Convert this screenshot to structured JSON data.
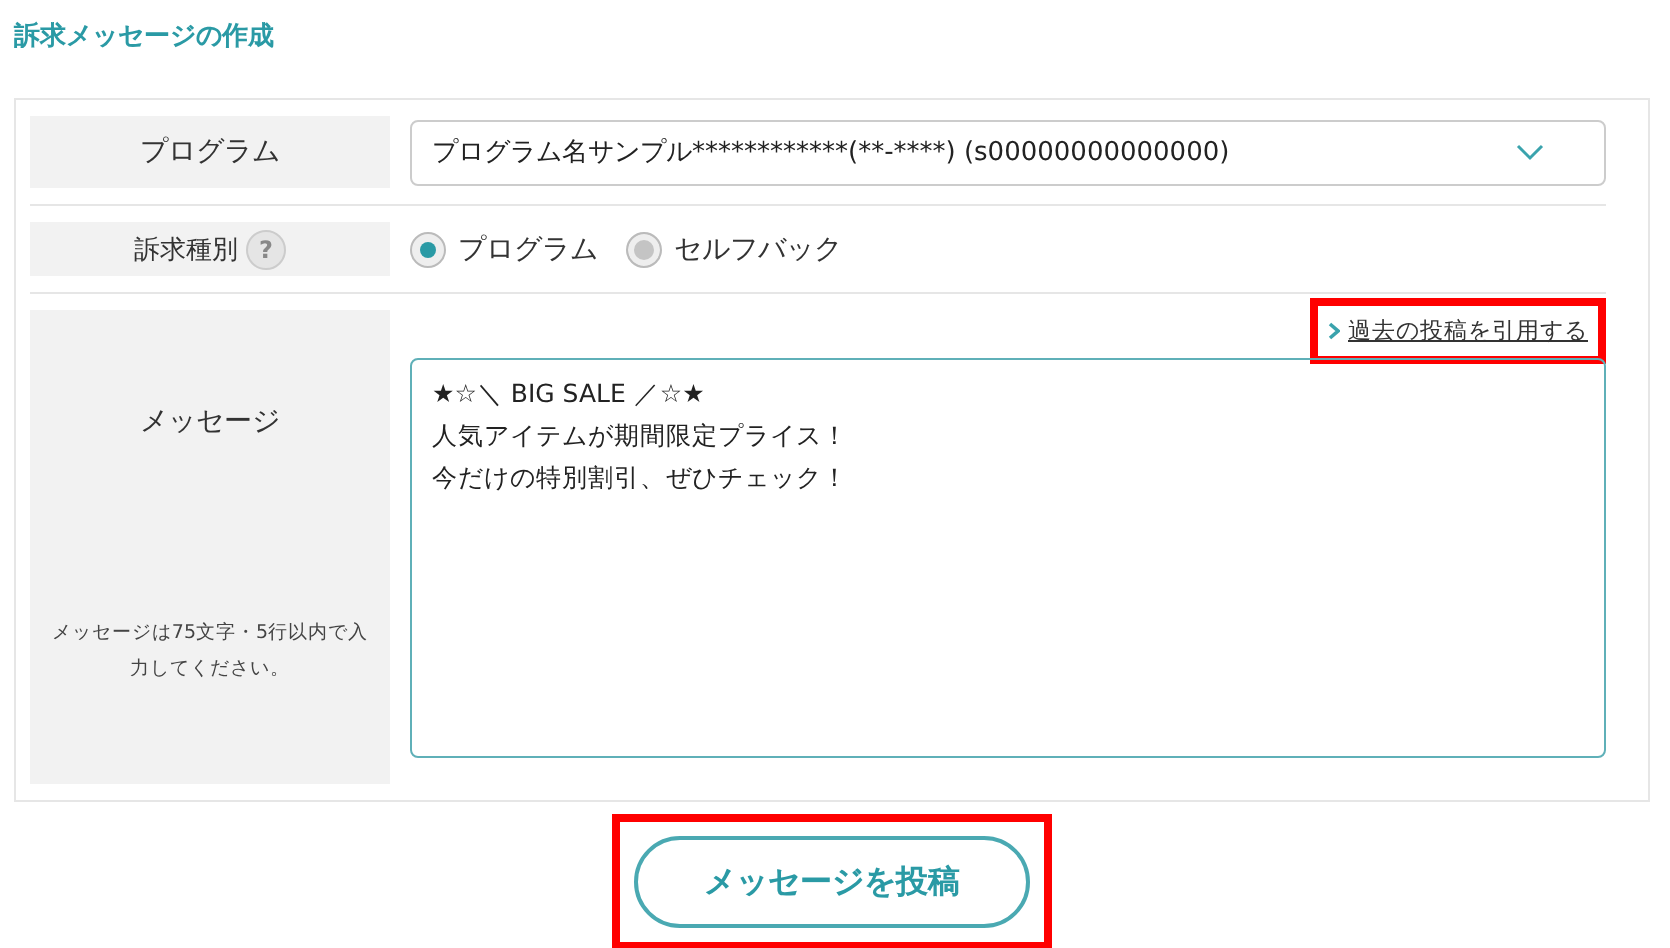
{
  "title": "訴求メッセージの作成",
  "form": {
    "program": {
      "label": "プログラム",
      "value": "プログラム名サンプル************(**-****) (s00000000000000)"
    },
    "appeal_type": {
      "label": "訴求種別",
      "help": "?",
      "options": [
        {
          "label": "プログラム",
          "selected": true
        },
        {
          "label": "セルフバック",
          "selected": false
        }
      ]
    },
    "message": {
      "label": "メッセージ",
      "note": "メッセージは75文字・5行以内で入力してください。",
      "quote_link": {
        "label": "過去の投稿を引用する",
        "highlighted": true
      },
      "lines": [
        "★☆＼ BIG SALE ／☆★",
        "人気アイテムが期間限定プライス！",
        "今だけの特別割引、ぜひチェック！"
      ]
    }
  },
  "submit": {
    "label": "メッセージを投稿",
    "highlighted": true
  }
}
